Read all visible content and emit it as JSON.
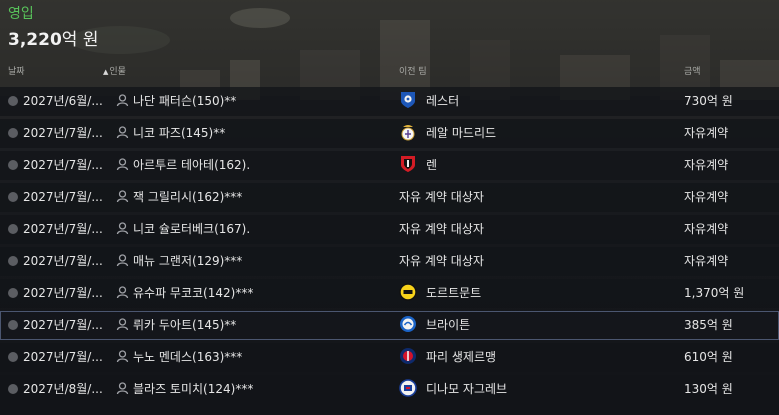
{
  "summary": {
    "label": "영입",
    "total_value": "3,220",
    "total_unit": "억 원"
  },
  "columns": {
    "date": "날짜",
    "player": "인물",
    "from_club": "이전 팀",
    "fee": "금액"
  },
  "sort_indicator": "▲",
  "rows": [
    {
      "date": "2027년/6월/...",
      "player": "나단 패터슨(150)**",
      "club": "레스터",
      "club_logo": "leicester-crest",
      "fee": "730억 원"
    },
    {
      "date": "2027년/7월/...",
      "player": "니코 파즈(145)**",
      "club": "레알 마드리드",
      "club_logo": "real-madrid-crest",
      "fee": "자유계약"
    },
    {
      "date": "2027년/7월/...",
      "player": "아르투르 테아테(162).",
      "club": "렌",
      "club_logo": "rennes-crest",
      "fee": "자유계약"
    },
    {
      "date": "2027년/7월/...",
      "player": "잭 그릴리시(162)***",
      "club": "자유 계약 대상자",
      "club_logo": "",
      "fee": "자유계약"
    },
    {
      "date": "2027년/7월/...",
      "player": "니코 슐로터베크(167).",
      "club": "자유 계약 대상자",
      "club_logo": "",
      "fee": "자유계약"
    },
    {
      "date": "2027년/7월/...",
      "player": "매뉴 그랜저(129)***",
      "club": "자유 계약 대상자",
      "club_logo": "",
      "fee": "자유계약"
    },
    {
      "date": "2027년/7월/...",
      "player": "유수파 무코코(142)***",
      "club": "도르트문트",
      "club_logo": "dortmund-crest",
      "fee": "1,370억 원"
    },
    {
      "date": "2027년/7월/...",
      "player": "뤼카 두아트(145)**",
      "club": "브라이튼",
      "club_logo": "brighton-crest",
      "fee": "385억 원"
    },
    {
      "date": "2027년/7월/...",
      "player": "누노 멘데스(163)***",
      "club": "파리 생제르맹",
      "club_logo": "psg-crest",
      "fee": "610억 원"
    },
    {
      "date": "2027년/8월/...",
      "player": "블라즈 토미치(124)***",
      "club": "디나모 자그레브",
      "club_logo": "dinamo-zagreb-crest",
      "fee": "130억 원"
    }
  ],
  "colors": {
    "accent_green": "#58c25a",
    "selected_outline": "#4b5670"
  }
}
